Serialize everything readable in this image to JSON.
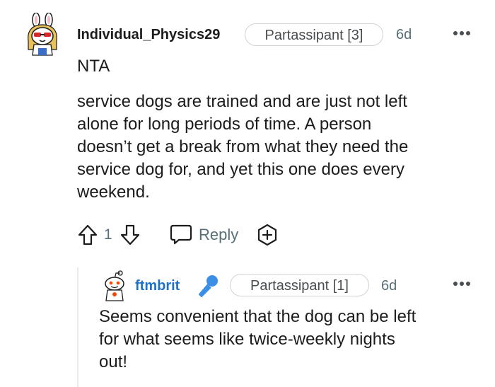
{
  "comment": {
    "username": "Individual_Physics29",
    "flair": "Partassipant [3]",
    "age": "6d",
    "body_line1": "NTA",
    "body_paragraph": "service dogs are trained and are just not left\nalone for long periods of time. A person\ndoesn’t get a break from what they need the\nservice dog for, and yet this one does every\nweekend.",
    "vote_count": "1",
    "reply_label": "Reply",
    "icons": {
      "upvote": "upvote-arrow-icon",
      "downvote": "downvote-arrow-icon",
      "reply": "speech-bubble-icon",
      "award": "award-plus-icon",
      "more": "more-options-icon"
    }
  },
  "reply": {
    "username": "ftmbrit",
    "flair": "Partassipant [1]",
    "age": "6d",
    "body": "Seems convenient that the dog can be left\nfor what seems like twice-weekly nights\nout!",
    "icons": {
      "badge": "microphone-icon",
      "more": "more-options-icon"
    }
  },
  "colors": {
    "text": "#1c1c1c",
    "meta": "#576f76",
    "link_username": "#1e72c9",
    "mic_blue": "#3a8ee6",
    "flair_border": "#cfd3d6",
    "thread_line": "#e5ebee"
  }
}
